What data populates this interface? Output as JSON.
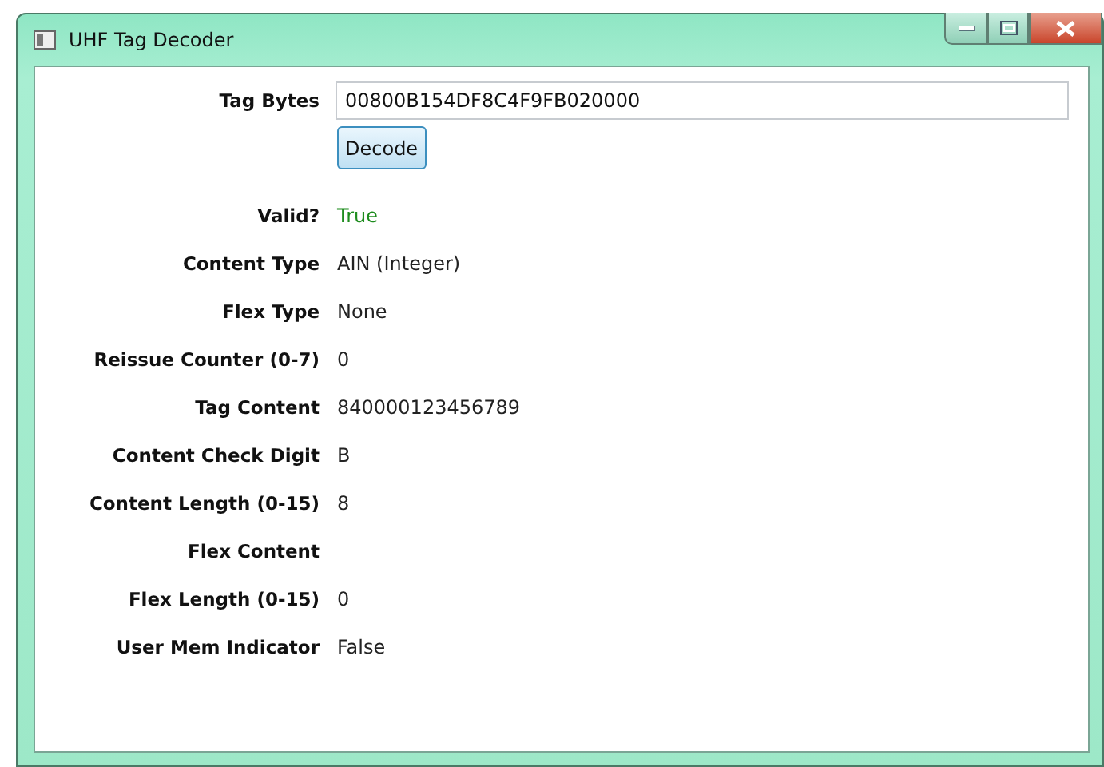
{
  "window": {
    "title": "UHF Tag Decoder"
  },
  "tag_bytes": {
    "label": "Tag Bytes",
    "value": "00800B154DF8C4F9FB020000"
  },
  "decode_button": {
    "label": "Decode"
  },
  "fields": [
    {
      "label": "Valid?",
      "value": "True",
      "kind": "status"
    },
    {
      "label": "Content Type",
      "value": "AIN (Integer)",
      "kind": "text"
    },
    {
      "label": "Flex Type",
      "value": "None",
      "kind": "text"
    },
    {
      "label": "Reissue Counter (0-7)",
      "value": "0",
      "kind": "text"
    },
    {
      "label": "Tag Content",
      "value": "840000123456789",
      "kind": "text"
    },
    {
      "label": "Content Check Digit",
      "value": "B",
      "kind": "text"
    },
    {
      "label": "Content Length (0-15)",
      "value": "8",
      "kind": "text"
    },
    {
      "label": "Flex Content"
    },
    {
      "label": "Flex Length (0-15)",
      "value": "0",
      "kind": "text"
    },
    {
      "label": "User Mem Indicator",
      "value": "False",
      "kind": "text"
    }
  ]
}
